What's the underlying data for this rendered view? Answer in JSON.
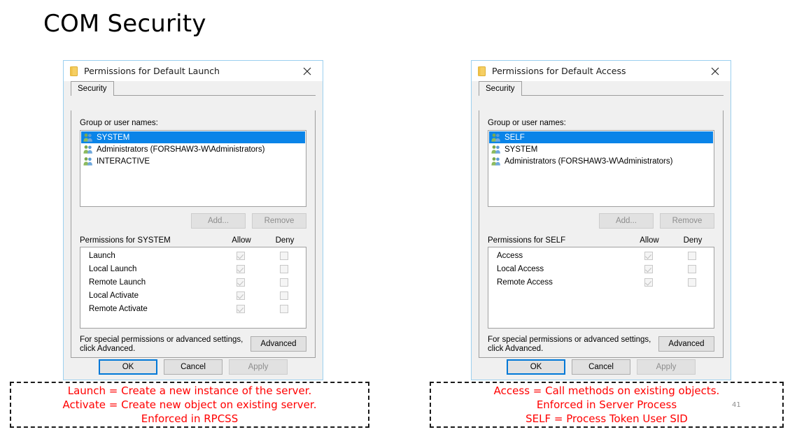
{
  "slide": {
    "title": "COM Security",
    "number": "41"
  },
  "dialogs": [
    {
      "id": "default-launch",
      "title": "Permissions for Default Launch",
      "folder_icon": "folder-icon",
      "close_icon": "close-icon",
      "tab": "Security",
      "group_label": "Group or user names:",
      "principals": [
        {
          "name": "SYSTEM",
          "selected": true
        },
        {
          "name": "Administrators (FORSHAW3-W\\Administrators)",
          "selected": false
        },
        {
          "name": "INTERACTIVE",
          "selected": false
        }
      ],
      "add_label": "Add...",
      "remove_label": "Remove",
      "perm_title": "Permissions for SYSTEM",
      "allow_label": "Allow",
      "deny_label": "Deny",
      "permissions": [
        {
          "name": "Launch",
          "allow": true,
          "deny": false
        },
        {
          "name": "Local Launch",
          "allow": true,
          "deny": false
        },
        {
          "name": "Remote Launch",
          "allow": true,
          "deny": false
        },
        {
          "name": "Local Activate",
          "allow": true,
          "deny": false
        },
        {
          "name": "Remote Activate",
          "allow": true,
          "deny": false
        }
      ],
      "advanced_note_line1": "For special permissions or advanced settings,",
      "advanced_note_line2": "click Advanced.",
      "advanced_label": "Advanced",
      "ok_label": "OK",
      "cancel_label": "Cancel",
      "apply_label": "Apply"
    },
    {
      "id": "default-access",
      "title": "Permissions for Default Access",
      "folder_icon": "folder-icon",
      "close_icon": "close-icon",
      "tab": "Security",
      "group_label": "Group or user names:",
      "principals": [
        {
          "name": "SELF",
          "selected": true
        },
        {
          "name": "SYSTEM",
          "selected": false
        },
        {
          "name": "Administrators (FORSHAW3-W\\Administrators)",
          "selected": false
        }
      ],
      "add_label": "Add...",
      "remove_label": "Remove",
      "perm_title": "Permissions for SELF",
      "allow_label": "Allow",
      "deny_label": "Deny",
      "permissions": [
        {
          "name": "Access",
          "allow": true,
          "deny": false
        },
        {
          "name": "Local Access",
          "allow": true,
          "deny": false
        },
        {
          "name": "Remote Access",
          "allow": true,
          "deny": false
        }
      ],
      "advanced_note_line1": "For special permissions or advanced settings,",
      "advanced_note_line2": "click Advanced.",
      "advanced_label": "Advanced",
      "ok_label": "OK",
      "cancel_label": "Cancel",
      "apply_label": "Apply"
    }
  ],
  "callouts": [
    {
      "id": "launch-callout",
      "color": "#ff0000",
      "lines": [
        "Launch = Create a new instance of the server.",
        "Activate = Create new object on existing server.",
        "Enforced in RPCSS"
      ]
    },
    {
      "id": "access-callout",
      "color": "#ff0000",
      "lines": [
        "Access = Call methods on existing objects.",
        "Enforced in Server Process",
        "SELF = Process Token User SID"
      ]
    }
  ]
}
